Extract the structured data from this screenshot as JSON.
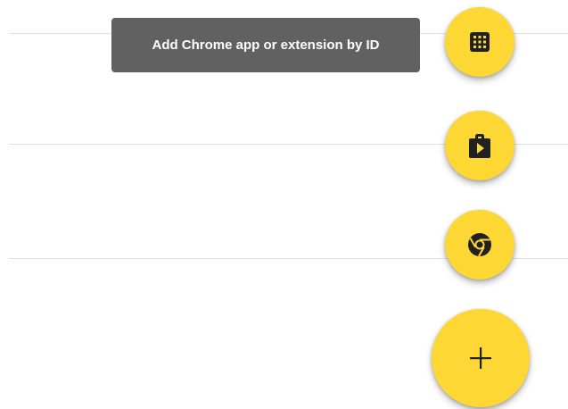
{
  "tooltip": {
    "text": "Add Chrome app or extension by ID"
  },
  "fab_menu": {
    "items": [
      {
        "icon": "apps-grid-icon",
        "action": "add-by-id"
      },
      {
        "icon": "play-store-icon",
        "action": "add-from-play-store"
      },
      {
        "icon": "chrome-icon",
        "action": "add-from-chrome-web-store"
      }
    ],
    "main_icon": "plus-icon"
  },
  "colors": {
    "fab_background": "#fdd835",
    "icon_color": "#212121",
    "tooltip_background": "#616161",
    "tooltip_text": "#ffffff",
    "divider": "#e0e0e0"
  }
}
